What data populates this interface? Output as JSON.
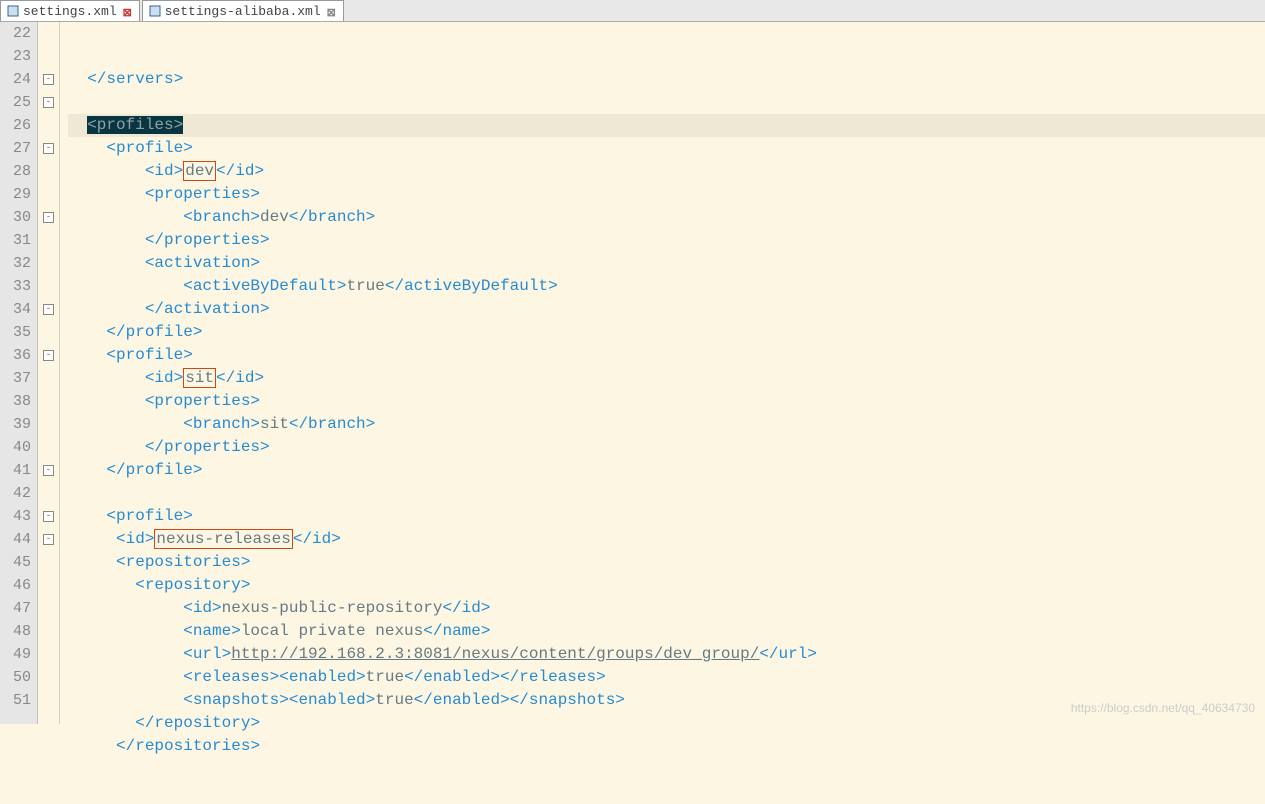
{
  "tabs": [
    {
      "label": "settings.xml",
      "active": true
    },
    {
      "label": "settings-alibaba.xml",
      "active": false
    }
  ],
  "lines": {
    "start": 22,
    "end": 51
  },
  "fold": {
    "l24": "-",
    "l25": "-",
    "l27": "-",
    "l30": "-",
    "l34": "-",
    "l36": "-",
    "l41": "-",
    "l43": "-",
    "l44": "-"
  },
  "code": {
    "l22": {
      "ind": "  ",
      "p1": "</servers>"
    },
    "l23": {
      "ind": ""
    },
    "l24": {
      "ind": "  ",
      "p1": "<profiles>"
    },
    "l25": {
      "ind": "    ",
      "p1": "<profile>"
    },
    "l26": {
      "ind": "        ",
      "p1": "<id>",
      "v": "dev",
      "p2": "</id>"
    },
    "l27": {
      "ind": "        ",
      "p1": "<properties>"
    },
    "l28": {
      "ind": "            ",
      "p1": "<branch>",
      "v": "dev",
      "p2": "</branch>"
    },
    "l29": {
      "ind": "        ",
      "p1": "</properties>"
    },
    "l30": {
      "ind": "        ",
      "p1": "<activation>"
    },
    "l31": {
      "ind": "            ",
      "p1": "<activeByDefault>",
      "v": "true",
      "p2": "</activeByDefault>"
    },
    "l32": {
      "ind": "        ",
      "p1": "</activation>"
    },
    "l33": {
      "ind": "    ",
      "p1": "</profile>"
    },
    "l34": {
      "ind": "    ",
      "p1": "<profile>"
    },
    "l35": {
      "ind": "        ",
      "p1": "<id>",
      "v": "sit",
      "p2": "</id>"
    },
    "l36": {
      "ind": "        ",
      "p1": "<properties>"
    },
    "l37": {
      "ind": "            ",
      "p1": "<branch>",
      "v": "sit",
      "p2": "</branch>"
    },
    "l38": {
      "ind": "        ",
      "p1": "</properties>"
    },
    "l39": {
      "ind": "    ",
      "p1": "</profile>"
    },
    "l40": {
      "ind": ""
    },
    "l41": {
      "ind": "    ",
      "p1": "<profile>"
    },
    "l42": {
      "ind": "     ",
      "p1": "<id>",
      "v": "nexus-releases",
      "p2": "</id>"
    },
    "l43": {
      "ind": "     ",
      "p1": "<repositories>"
    },
    "l44": {
      "ind": "       ",
      "p1": "<repository>"
    },
    "l45": {
      "ind": "            ",
      "p1": "<id>",
      "v": "nexus-public-repository",
      "p2": "</id>"
    },
    "l46": {
      "ind": "            ",
      "p1": "<name>",
      "v": "local private nexus",
      "p2": "</name>"
    },
    "l47": {
      "ind": "            ",
      "p1": "<url>",
      "v": "http://192.168.2.3:8081/nexus/content/groups/dev_group/",
      "p2": "</url>"
    },
    "l48": {
      "ind": "            ",
      "p1": "<releases>",
      "p2": "<enabled>",
      "v": "true",
      "p3": "</enabled>",
      "p4": "</releases>"
    },
    "l49": {
      "ind": "            ",
      "p1": "<snapshots>",
      "p2": "<enabled>",
      "v": "true",
      "p3": "</enabled>",
      "p4": "</snapshots>"
    },
    "l50": {
      "ind": "       ",
      "p1": "</repository>"
    },
    "l51": {
      "ind": "     ",
      "p1": "</repositories>"
    }
  },
  "highlights": {
    "boxed": [
      "l26",
      "l35",
      "l42"
    ],
    "selected_line": "l24"
  },
  "watermark": "https://blog.csdn.net/qq_40634730"
}
